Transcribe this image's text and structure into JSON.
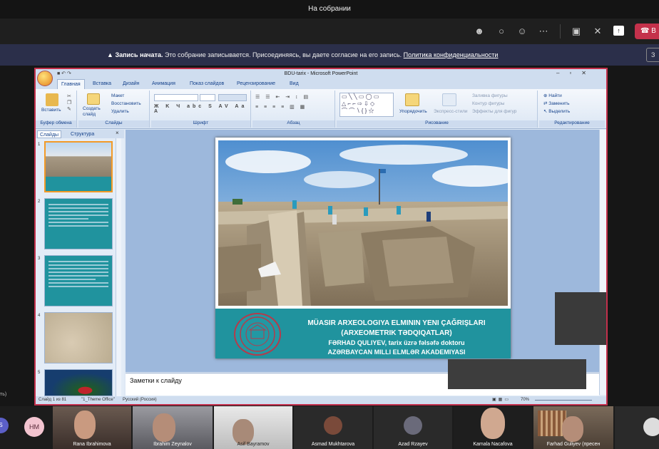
{
  "window": {
    "title": "На собрании"
  },
  "toolbar": {
    "icons": [
      "people-icon",
      "chat-icon",
      "reactions-icon",
      "more-icon",
      "camera-off-icon",
      "mic-off-icon",
      "share-icon"
    ],
    "leave_label": "В"
  },
  "banner": {
    "bold": "Запись начата.",
    "text": "Это собрание записывается. Присоединяясь, вы даете согласие на его запись.",
    "link": "Политика конфиденциальности",
    "close": "З"
  },
  "ppt": {
    "title": "BDU-tarix - Microsoft PowerPoint",
    "tabs": [
      "Главная",
      "Вставка",
      "Дизайн",
      "Анимация",
      "Показ слайдов",
      "Рецензирование",
      "Вид"
    ],
    "groups": {
      "clipboard": "Буфер обмена",
      "slides": "Слайды",
      "font": "Шрифт",
      "paragraph": "Абзац",
      "drawing": "Рисование",
      "editing": "Редактирование"
    },
    "buttons": {
      "paste": "Вставить",
      "new_slide": "Создать слайд",
      "layout": "Макет",
      "reset": "Восстановить",
      "delete": "Удалить",
      "arrange": "Упорядочить",
      "quick_styles": "Экспресс-стили",
      "shape_fill": "Заливка фигуры",
      "shape_outline": "Контур фигуры",
      "shape_effects": "Эффекты для фигур",
      "find": "Найти",
      "replace": "Заменить",
      "select": "Выделить"
    },
    "panel_tabs": [
      "Слайды",
      "Структура"
    ],
    "thumb_numbers": [
      "1",
      "2",
      "3",
      "4",
      "5"
    ],
    "slide": {
      "line1": "MÜASIR ARXEOLOGIYA ELMININ YENI ÇAĞRIŞLARI",
      "line2": "(ARXEOMETRIK TƏDQIQATLAR)",
      "line3": "FƏRHAD QULIYEV, tarix üzrə fəlsəfə doktoru",
      "line4": "AZƏRBAYCAN MILLI ELMLƏR AKADEMIYASI"
    },
    "notes": "Заметки к слайду",
    "status": {
      "slide": "Слайд 1 из 81",
      "theme": "\"1_Theme Office\"",
      "lang": "Русский (Россия)",
      "zoom": "70%"
    }
  },
  "left_label": "ть)",
  "participants": [
    {
      "initials": "S",
      "name": ""
    },
    {
      "initials": "НМ",
      "name": ""
    },
    {
      "name": "Rana Ibrahimova"
    },
    {
      "name": "Ibrahim Zeynalov"
    },
    {
      "name": "Asif Bayramov"
    },
    {
      "name": "Asmad Mukhtarova"
    },
    {
      "name": "Azad Rzayev"
    },
    {
      "name": "Kamala Nacafova"
    },
    {
      "name": "Farhad Guliyev (пресен"
    }
  ]
}
